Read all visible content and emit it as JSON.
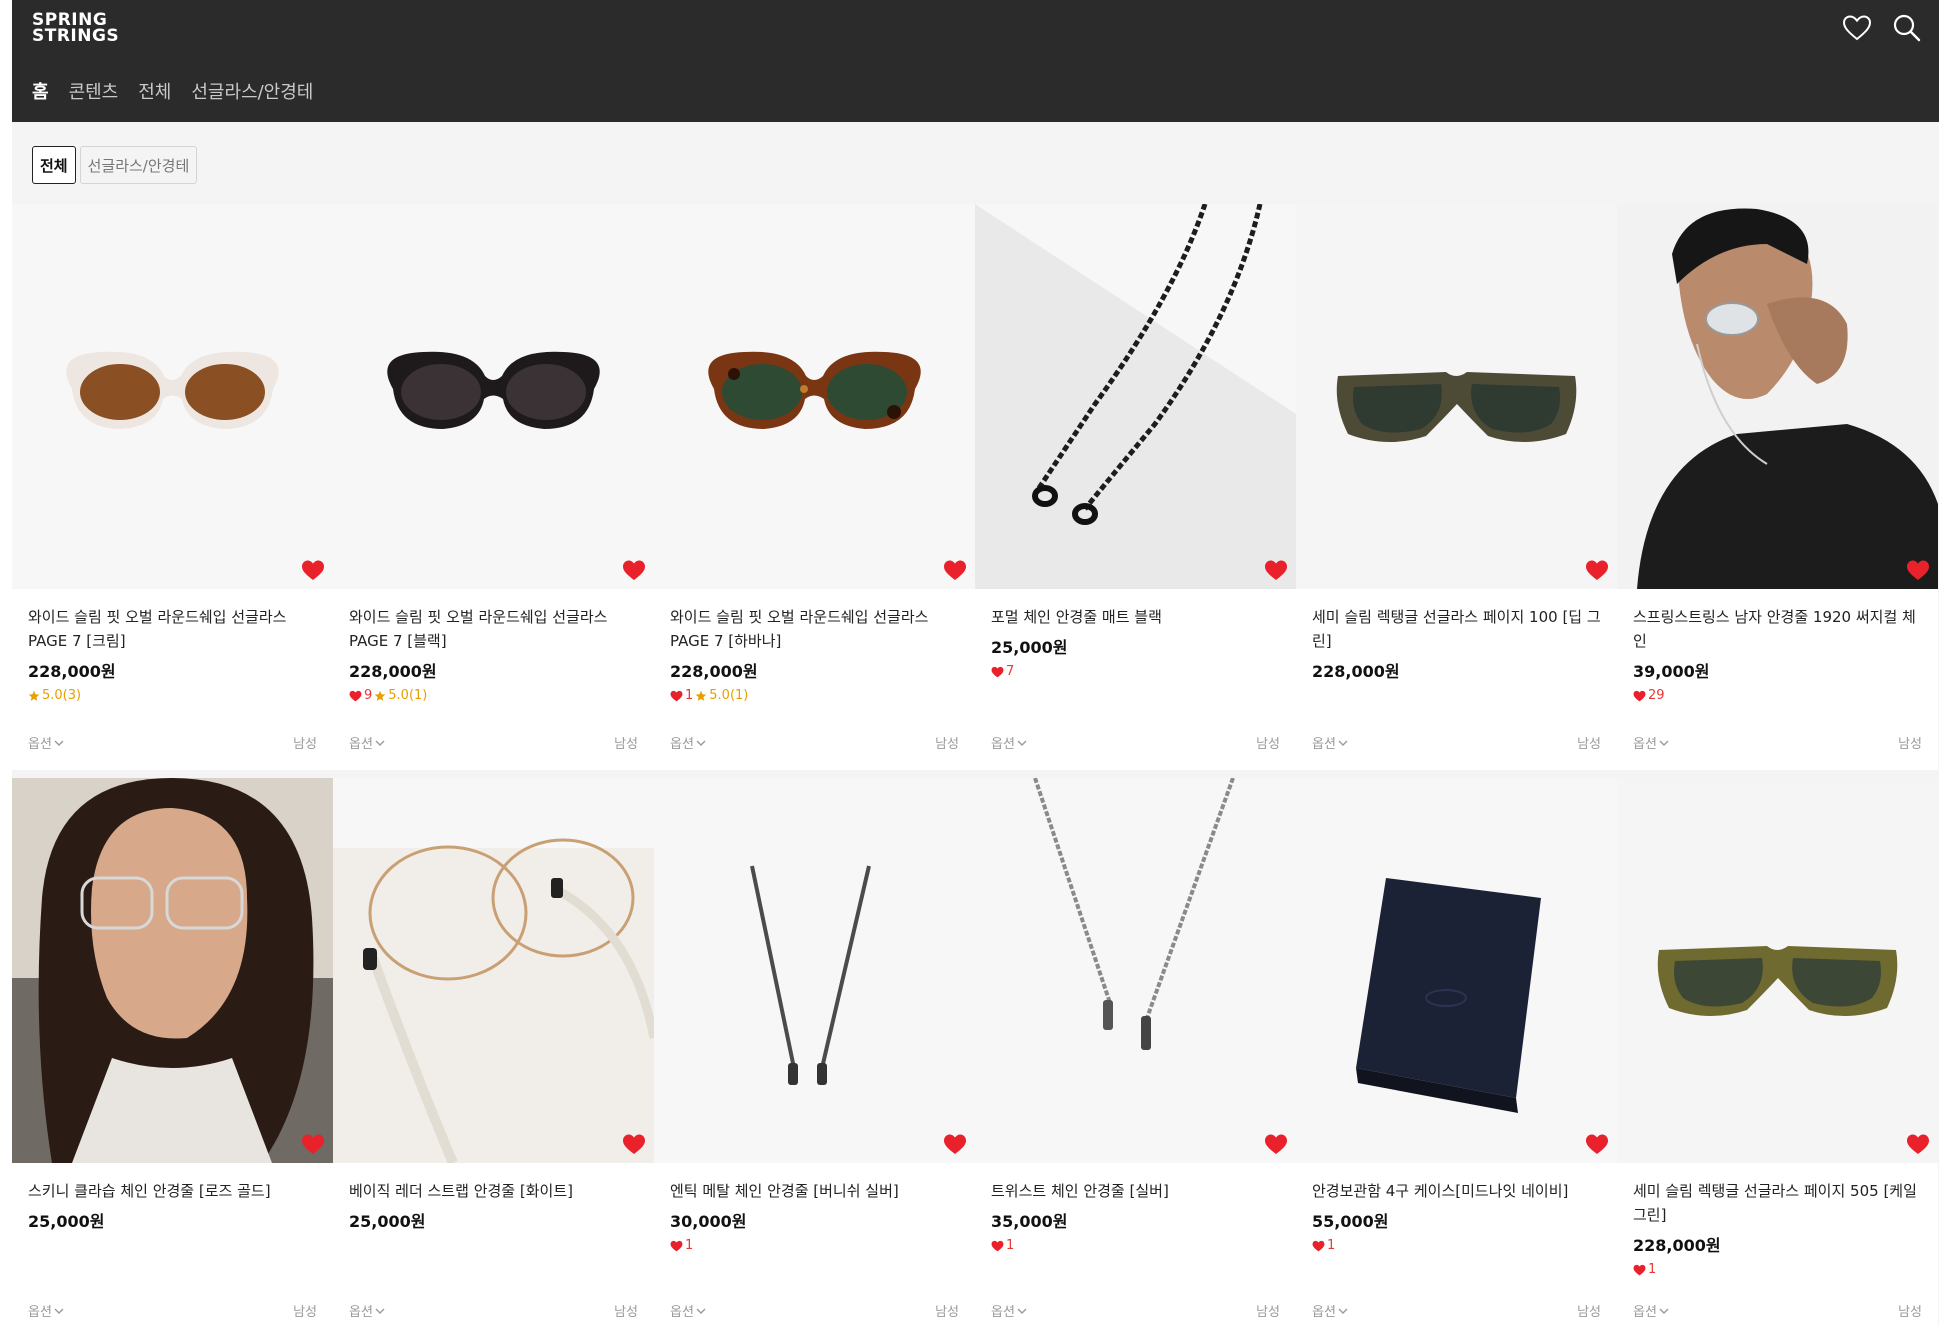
{
  "brand": {
    "line1": "SPRING",
    "line2": "STRINGS"
  },
  "nav": [
    "홈",
    "콘텐츠",
    "전체",
    "선글라스/안경테"
  ],
  "filters": [
    "전체",
    "선글라스/안경테"
  ],
  "labels": {
    "option": "옵션",
    "gender": "남성"
  },
  "products": [
    {
      "name": "와이드 슬림 핏 오벌 라운드쉐입 선글라스 PAGE 7 [크림]",
      "price": "228,000원",
      "likes": "",
      "rating": "5.0(3)",
      "image": "sunglasses-cream"
    },
    {
      "name": "와이드 슬림 핏 오벌 라운드쉐입 선글라스 PAGE 7 [블랙]",
      "price": "228,000원",
      "likes": "9",
      "rating": "5.0(1)",
      "image": "sunglasses-black"
    },
    {
      "name": "와이드 슬림 핏 오벌 라운드쉐입 선글라스 PAGE 7 [하바나]",
      "price": "228,000원",
      "likes": "1",
      "rating": "5.0(1)",
      "image": "sunglasses-havana"
    },
    {
      "name": "포멀 체인 안경줄 매트 블랙",
      "price": "25,000원",
      "likes": "7",
      "rating": "",
      "image": "chain-black"
    },
    {
      "name": "세미 슬림 렉탱글 선글라스 페이지 100 [딥 그린]",
      "price": "228,000원",
      "likes": "",
      "rating": "",
      "image": "sunglasses-deep-green"
    },
    {
      "name": "스프링스트링스 남자 안경줄 1920 써지컬 체인",
      "price": "39,000원",
      "likes": "29",
      "rating": "",
      "image": "model-man"
    },
    {
      "name": "스키니 클라습 체인 안경줄 [로즈 골드]",
      "price": "25,000원",
      "likes": "",
      "rating": "",
      "image": "model-woman"
    },
    {
      "name": "베이직 레더 스트랩 안경줄 [화이트]",
      "price": "25,000원",
      "likes": "",
      "rating": "",
      "image": "leather-strap-white"
    },
    {
      "name": "엔틱 메탈 체인 안경줄 [버니쉬 실버]",
      "price": "30,000원",
      "likes": "1",
      "rating": "",
      "image": "metal-chain-silver"
    },
    {
      "name": "트위스트 체인 안경줄 [실버]",
      "price": "35,000원",
      "likes": "1",
      "rating": "",
      "image": "twist-chain-silver"
    },
    {
      "name": "안경보관함 4구 케이스[미드나잇 네이비]",
      "price": "55,000원",
      "likes": "1",
      "rating": "",
      "image": "case-navy"
    },
    {
      "name": "세미 슬림 렉탱글 선글라스 페이지 505 [케일 그린]",
      "price": "228,000원",
      "likes": "1",
      "rating": "",
      "image": "sunglasses-kale-green"
    }
  ],
  "colors": {
    "header_bg": "#2b2b2b",
    "heart": "#e8212a",
    "star": "#e6a100"
  }
}
